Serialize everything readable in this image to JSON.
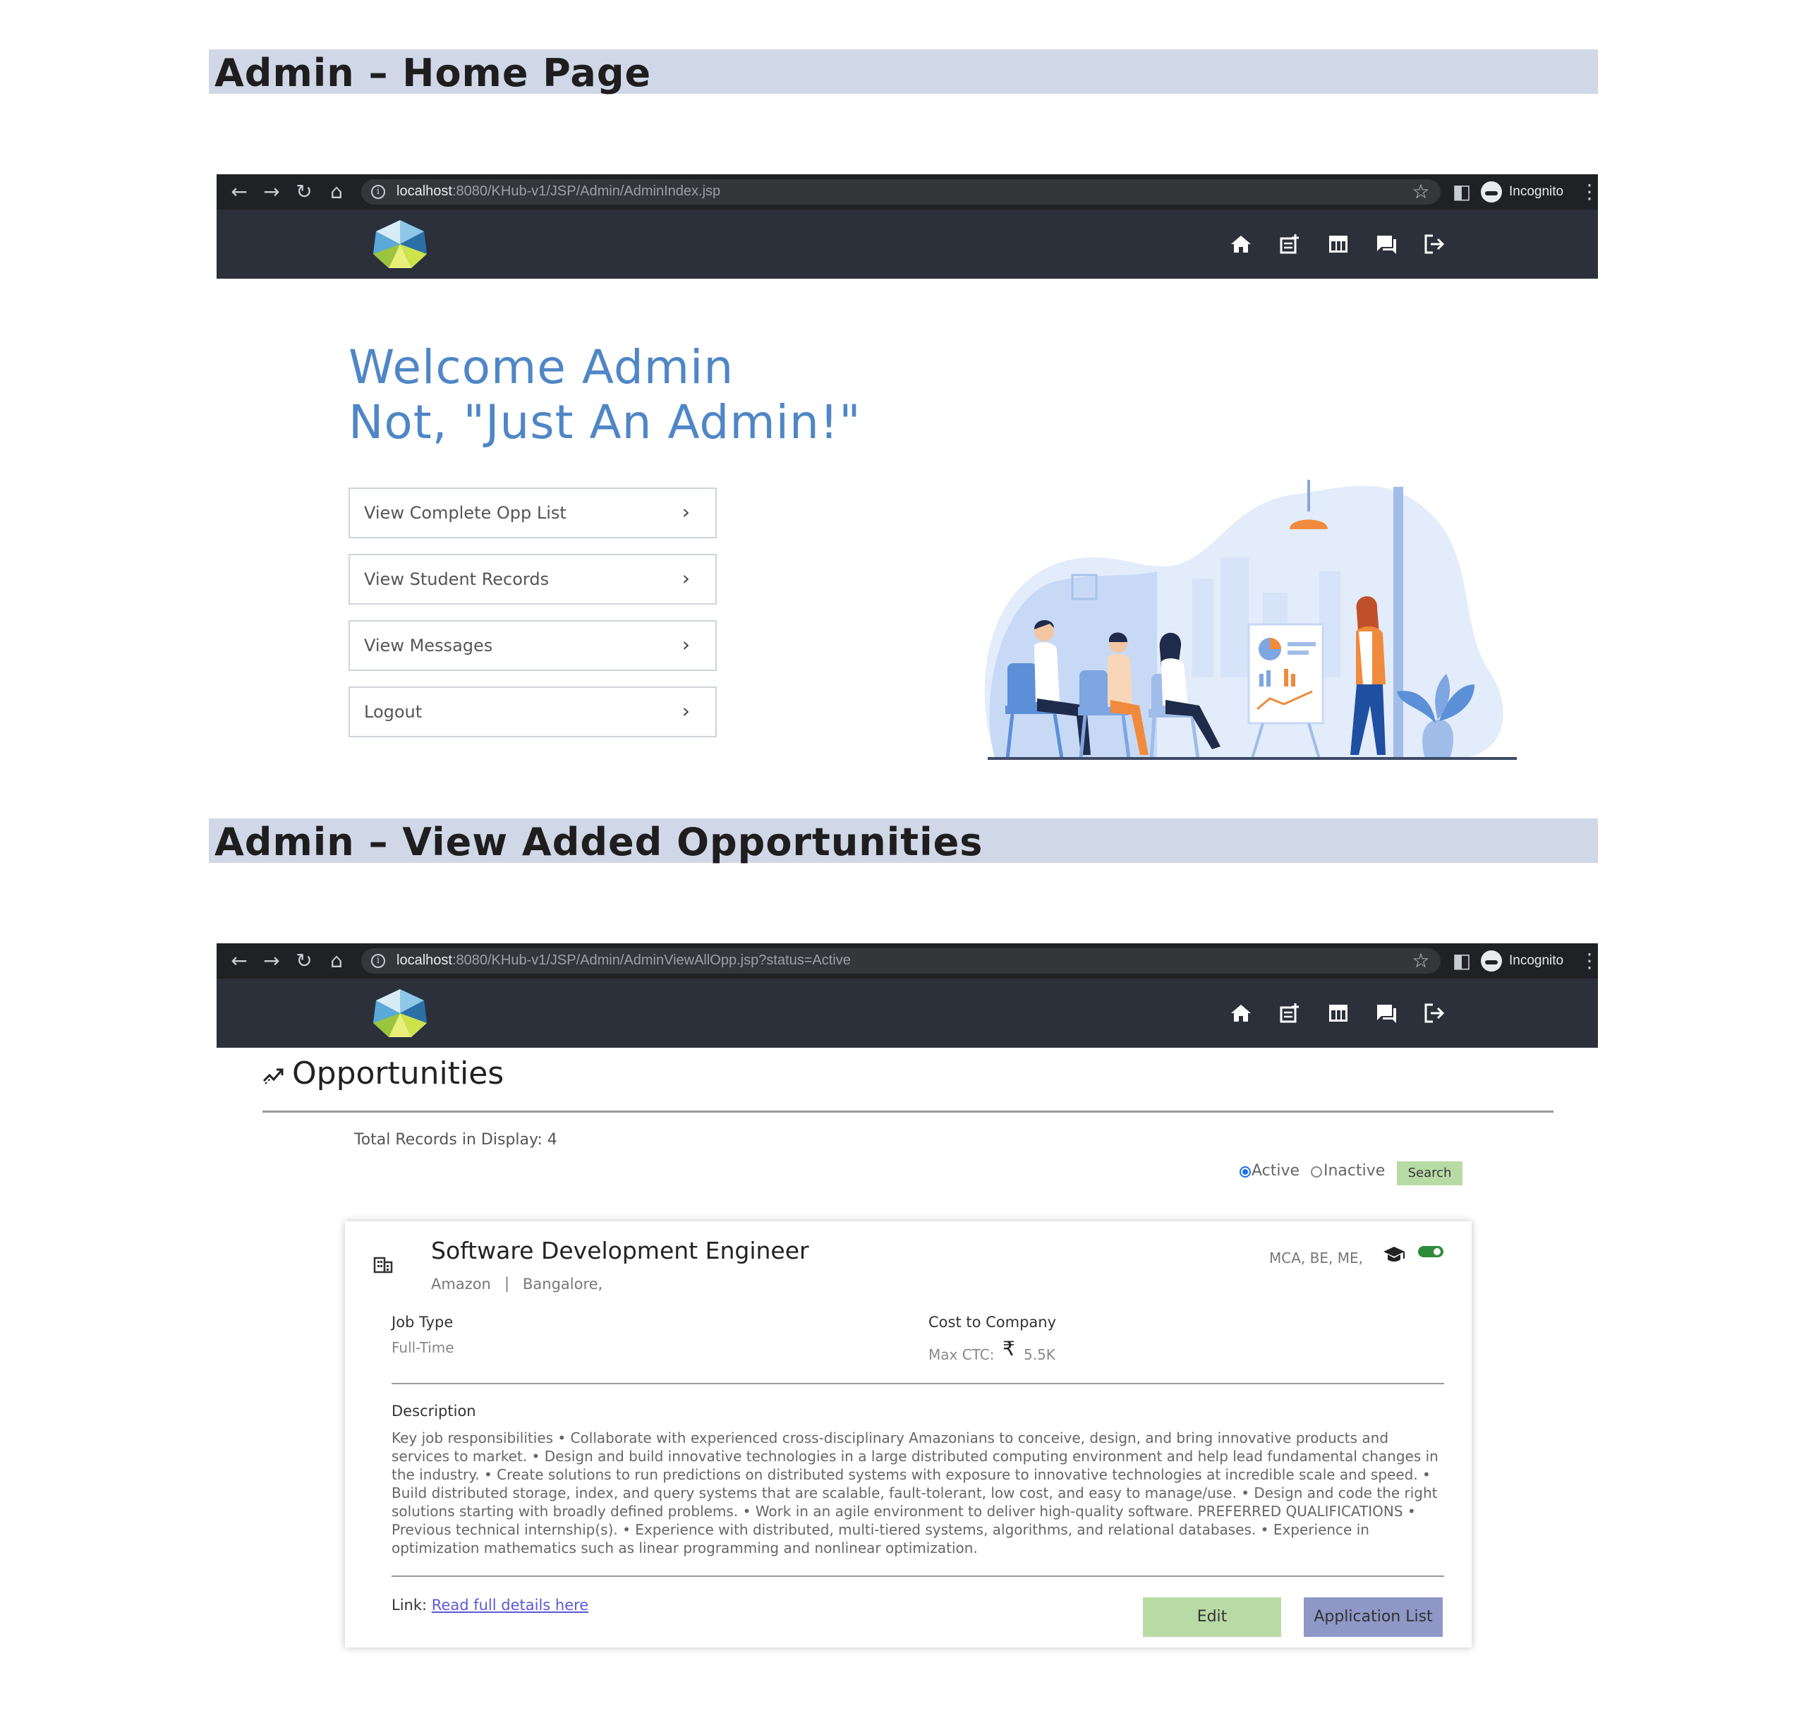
{
  "sections": [
    {
      "heading": "Admin – Home Page",
      "browser": {
        "url_host": "localhost",
        "url_path": ":8080/KHub-v1/JSP/Admin/AdminIndex.jsp",
        "incognito_label": "Incognito"
      }
    },
    {
      "heading": "Admin – View Added Opportunities",
      "browser": {
        "url_host": "localhost",
        "url_path": ":8080/KHub-v1/JSP/Admin/AdminViewAllOpp.jsp?status=Active",
        "incognito_label": "Incognito"
      }
    }
  ],
  "home": {
    "welcome_line1": "Welcome Admin",
    "welcome_line2": "Not, \"Just An Admin!\"",
    "menu": [
      {
        "label": "View Complete Opp List"
      },
      {
        "label": "View Student Records"
      },
      {
        "label": "View Messages"
      },
      {
        "label": "Logout"
      }
    ]
  },
  "opportunities": {
    "title": "Opportunities",
    "total_records": "Total Records in Display: 4",
    "filter": {
      "active_label": "Active",
      "inactive_label": "Inactive",
      "selected": "Active",
      "search_label": "Search"
    },
    "card": {
      "job_title": "Software Development Engineer",
      "company": "Amazon",
      "separator": "|",
      "location": "Bangalore,",
      "qualifications": "MCA, BE, ME,",
      "job_type_label": "Job Type",
      "job_type_value": "Full-Time",
      "ctc_label": "Cost to Company",
      "ctc_prefix": "Max CTC:",
      "ctc_currency": "₹",
      "ctc_value": "5.5K",
      "description_label": "Description",
      "description": "Key job responsibilities • Collaborate with experienced cross-disciplinary Amazonians to conceive, design, and bring innovative products and services to market. • Design and build innovative technologies in a large distributed computing environment and help lead fundamental changes in the industry. • Create solutions to run predictions on distributed systems with exposure to innovative technologies at incredible scale and speed. • Build distributed storage, index, and query systems that are scalable, fault-tolerant, low cost, and easy to manage/use. • Design and code the right solutions starting with broadly defined problems. • Work in an agile environment to deliver high-quality software. PREFERRED QUALIFICATIONS • Previous technical internship(s). • Experience with distributed, multi-tiered systems, algorithms, and relational databases. • Experience in optimization mathematics such as linear programming and nonlinear optimization.",
      "link_label": "Link:",
      "link_text": "Read full details here",
      "edit_label": "Edit",
      "app_list_label": "Application List",
      "status_active": true
    }
  },
  "icons": {
    "nav": [
      "home-icon",
      "add-post-icon",
      "table-icon",
      "messages-icon",
      "logout-icon"
    ],
    "browser": [
      "back-icon",
      "forward-icon",
      "reload-icon",
      "browser-home-icon",
      "info-icon",
      "star-icon",
      "side-panel-icon",
      "incognito-icon",
      "kebab-menu-icon"
    ]
  },
  "colors": {
    "heading_band": "#d0d7e6",
    "chrome_bar": "#202124",
    "app_nav": "#2b303b",
    "welcome_text": "#4f86c6",
    "search_button": "#b8dba6",
    "edit_button": "#b8dba6",
    "application_list_button": "#8e97c6",
    "toggle_green": "#2e8b3a"
  }
}
